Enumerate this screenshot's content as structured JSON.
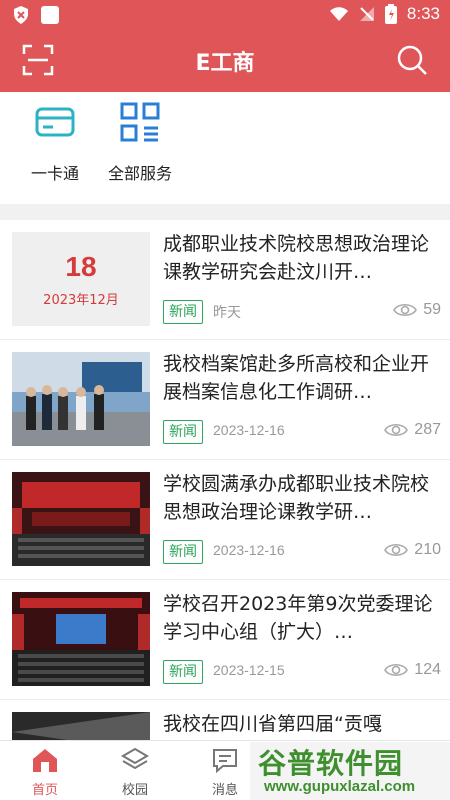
{
  "status_bar": {
    "time": "8:33"
  },
  "app_bar": {
    "title": "E工商"
  },
  "quick_actions": [
    {
      "label": "一卡通",
      "icon": "card-icon"
    },
    {
      "label": "全部服务",
      "icon": "grid-menu-icon"
    }
  ],
  "news": [
    {
      "thumb": "date",
      "day": "18",
      "year_month": "2023年12月",
      "title": "成都职业技术院校思想政治理论课教学研究会赴汶川开…",
      "tag": "新闻",
      "date": "昨天",
      "views": "59"
    },
    {
      "thumb": "photo",
      "title": "我校档案馆赴多所高校和企业开展档案信息化工作调研…",
      "tag": "新闻",
      "date": "2023-12-16",
      "views": "287"
    },
    {
      "thumb": "photo",
      "title": "学校圆满承办成都职业技术院校思想政治理论课教学研…",
      "tag": "新闻",
      "date": "2023-12-16",
      "views": "210"
    },
    {
      "thumb": "photo",
      "title": "学校召开2023年第9次党委理论学习中心组（扩大）…",
      "tag": "新闻",
      "date": "2023-12-15",
      "views": "124"
    },
    {
      "thumb": "photo",
      "title": "我校在四川省第四届“贡嘎",
      "tag": "",
      "date": "",
      "views": ""
    }
  ],
  "tabs": [
    {
      "label": "首页",
      "icon": "home-icon"
    },
    {
      "label": "校园",
      "icon": "layers-icon"
    },
    {
      "label": "消息",
      "icon": "message-icon"
    }
  ],
  "watermark": {
    "big": "谷普软件园",
    "url": "www.gupuxlazal.com"
  },
  "colors": {
    "brand": "#e05658",
    "tag_green": "#2aa55a",
    "accent_teal": "#2bb3c4",
    "accent_blue": "#2a7fd4"
  }
}
